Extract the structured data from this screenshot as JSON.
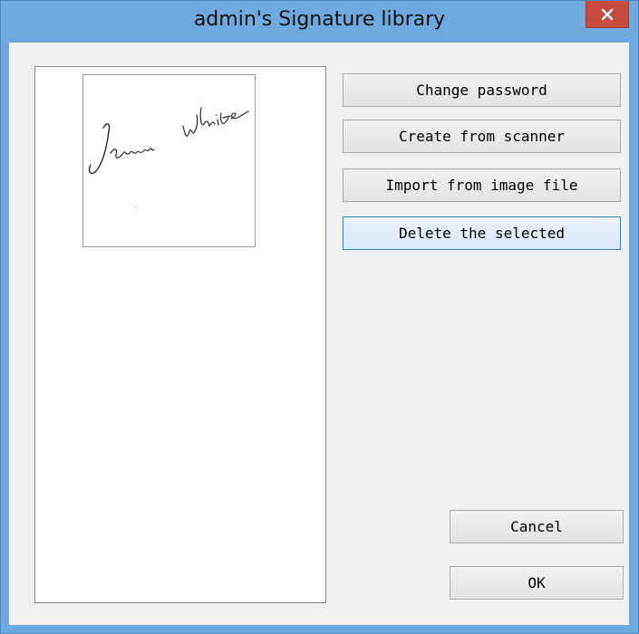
{
  "window": {
    "title": "admin's Signature library",
    "close_icon": "close-icon"
  },
  "signatures": [
    {
      "text": "James White",
      "selected": false
    }
  ],
  "actions": {
    "change_password": "Change password",
    "create_from_scanner": "Create from scanner",
    "import_from_image": "Import from image file",
    "delete_selected": "Delete the selected"
  },
  "footer": {
    "cancel": "Cancel",
    "ok": "OK"
  }
}
